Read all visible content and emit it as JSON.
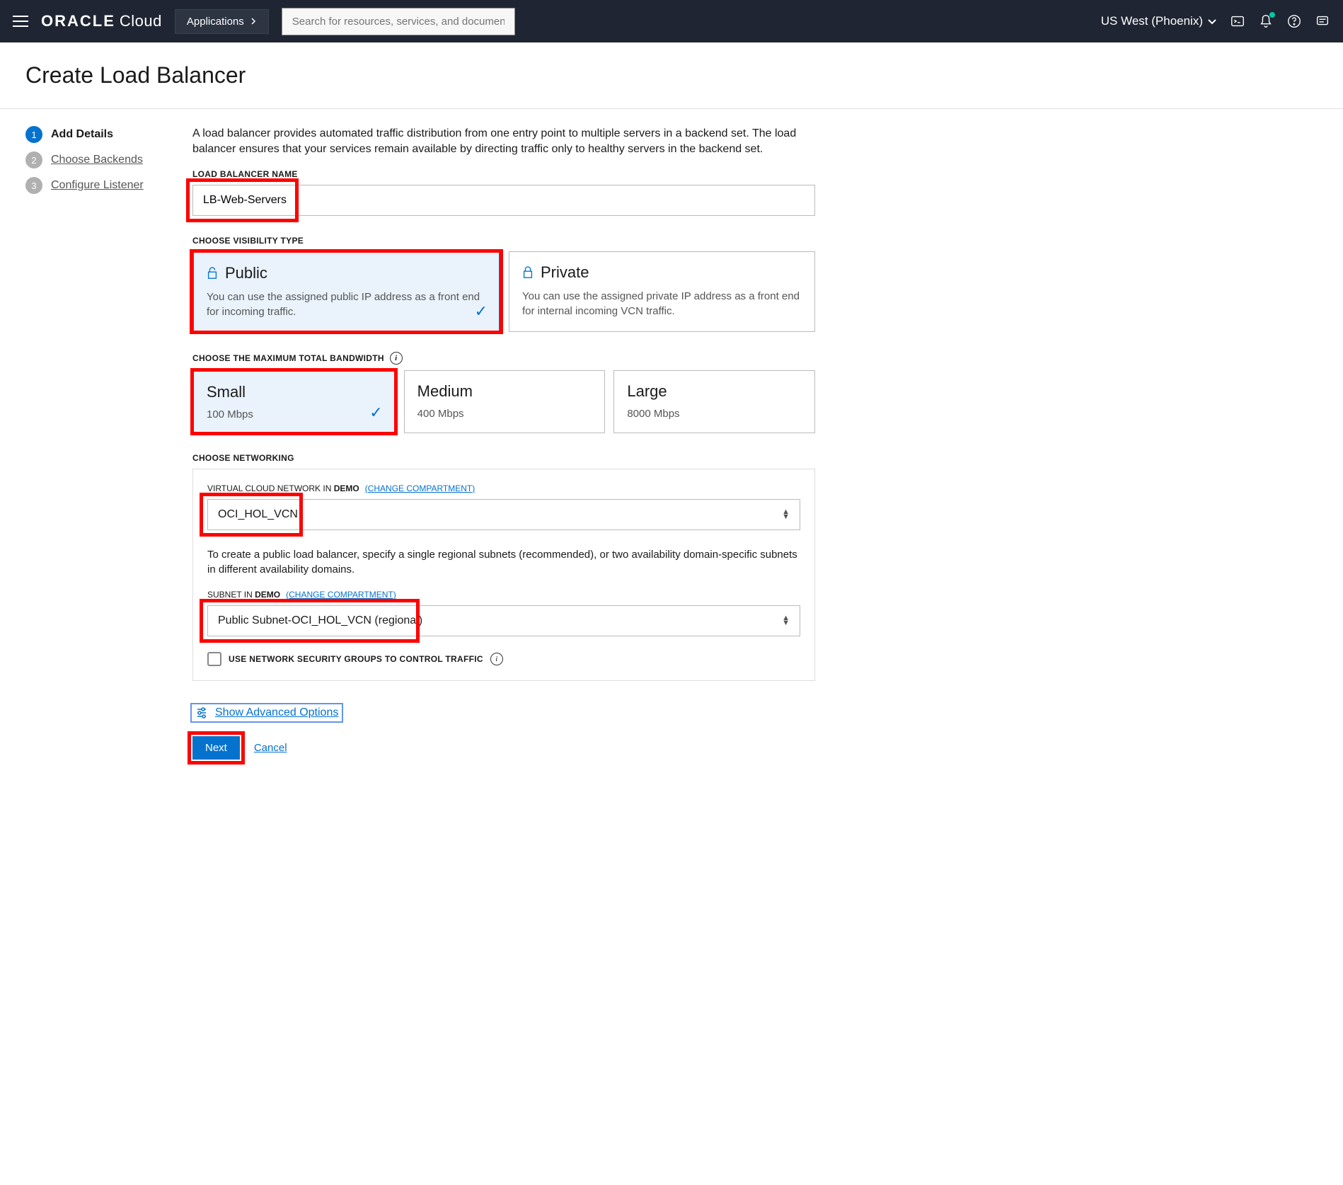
{
  "header": {
    "logo_oracle": "ORACLE",
    "logo_cloud": "Cloud",
    "applications": "Applications",
    "search_placeholder": "Search for resources, services, and documentation",
    "region": "US West (Phoenix)"
  },
  "page": {
    "title": "Create Load Balancer"
  },
  "steps": [
    {
      "num": "1",
      "label": "Add Details",
      "active": true
    },
    {
      "num": "2",
      "label": "Choose Backends",
      "active": false
    },
    {
      "num": "3",
      "label": "Configure Listener",
      "active": false
    }
  ],
  "form": {
    "intro": "A load balancer provides automated traffic distribution from one entry point to multiple servers in a backend set. The load balancer ensures that your services remain available by directing traffic only to healthy servers in the backend set.",
    "name_label": "LOAD BALANCER NAME",
    "name_value": "LB-Web-Servers",
    "visibility_label": "CHOOSE VISIBILITY TYPE",
    "visibility": [
      {
        "title": "Public",
        "desc": "You can use the assigned public IP address as a front end for incoming traffic.",
        "selected": true
      },
      {
        "title": "Private",
        "desc": "You can use the assigned private IP address as a front end for internal incoming VCN traffic.",
        "selected": false
      }
    ],
    "bandwidth_label": "CHOOSE THE MAXIMUM TOTAL BANDWIDTH",
    "bandwidth": [
      {
        "title": "Small",
        "sub": "100 Mbps",
        "selected": true
      },
      {
        "title": "Medium",
        "sub": "400 Mbps",
        "selected": false
      },
      {
        "title": "Large",
        "sub": "8000 Mbps",
        "selected": false
      }
    ],
    "networking_label": "CHOOSE NETWORKING",
    "vcn_label_prefix": "VIRTUAL CLOUD NETWORK IN",
    "vcn_compartment": "DEMO",
    "change_compartment": "(CHANGE COMPARTMENT)",
    "vcn_value": "OCI_HOL_VCN",
    "subnet_desc": "To create a public load balancer, specify a single regional subnets (recommended), or two availability domain-specific subnets in different availability domains.",
    "subnet_label_prefix": "SUBNET IN",
    "subnet_compartment": "DEMO",
    "subnet_value": "Public Subnet-OCI_HOL_VCN (regional)",
    "nsg_label": "USE NETWORK SECURITY GROUPS TO CONTROL TRAFFIC",
    "advanced": "Show Advanced Options",
    "next": "Next",
    "cancel": "Cancel"
  }
}
